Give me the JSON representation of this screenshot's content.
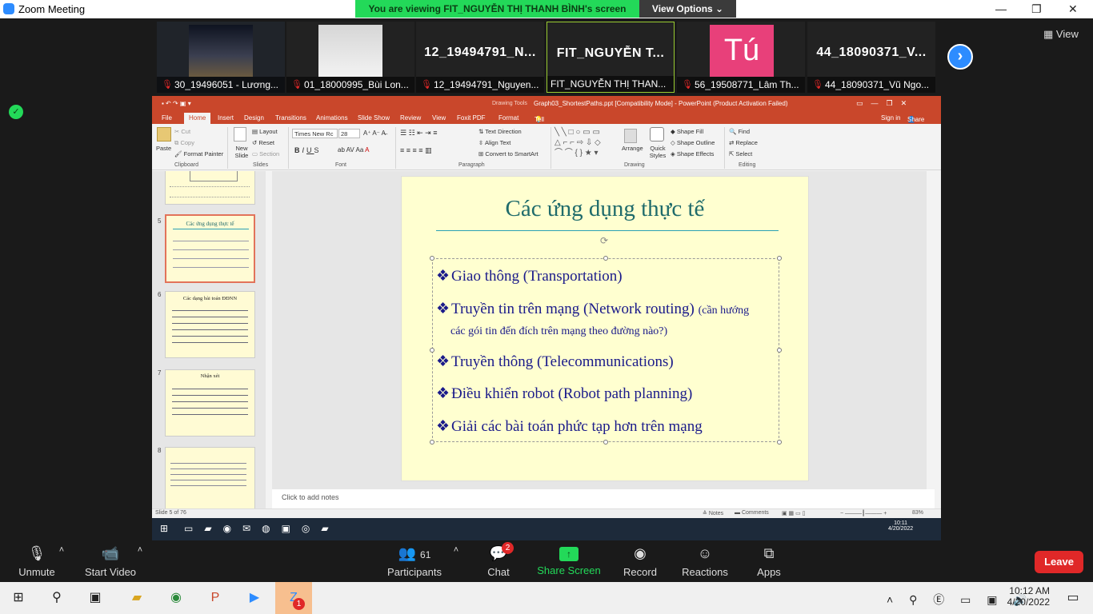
{
  "window": {
    "title": "Zoom Meeting",
    "share_banner": "You are viewing FIT_NGUYỄN THỊ THANH BÌNH's screen",
    "view_options": "View Options",
    "view_button": "View"
  },
  "participants_strip": [
    {
      "label": "30_19496051 - Lương...",
      "big": ""
    },
    {
      "label": "01_18000995_Bùi Lon...",
      "big": ""
    },
    {
      "label": "12_19494791_Nguyen...",
      "big": "12_19494791_N..."
    },
    {
      "label": "FIT_NGUYỄN THỊ THAN...",
      "big": "FIT_NGUYỄN T..."
    },
    {
      "label": "56_19508771_Lâm Th...",
      "big": "Tú"
    },
    {
      "label": "44_18090371_Vũ Ngo...",
      "big": "44_18090371_V..."
    }
  ],
  "ppt": {
    "title": "Graph03_ShortestPaths.ppt [Compatibility Mode] - PowerPoint (Product Activation Failed)",
    "drawing_tools": "Drawing Tools",
    "signin": "Sign in",
    "share": "Share",
    "tabs": [
      "File",
      "Home",
      "Insert",
      "Design",
      "Transitions",
      "Animations",
      "Slide Show",
      "Review",
      "View",
      "Foxit PDF",
      "Format"
    ],
    "tellme": "Tell me what you want to do...",
    "ribbon": {
      "paste": "Paste",
      "cut": "Cut",
      "copy": "Copy",
      "format_painter": "Format Painter",
      "new_slide": "New Slide",
      "layout": "Layout",
      "reset": "Reset",
      "section": "Section",
      "font_name": "Times New Rc",
      "font_size": "28",
      "text_direction": "Text Direction",
      "align_text": "Align Text",
      "convert_smartart": "Convert to SmartArt",
      "arrange": "Arrange",
      "quick_styles": "Quick Styles",
      "shape_fill": "Shape Fill",
      "shape_outline": "Shape Outline",
      "shape_effects": "Shape Effects",
      "find": "Find",
      "replace": "Replace",
      "select": "Select",
      "groups": [
        "Clipboard",
        "Slides",
        "Font",
        "Paragraph",
        "Drawing",
        "Editing"
      ]
    },
    "thumbnails": [
      {
        "num": "5",
        "title": "Các ứng dụng thực tế"
      },
      {
        "num": "6",
        "title": "Các dạng bài toán ĐĐNN"
      },
      {
        "num": "7",
        "title": "Nhận xét"
      },
      {
        "num": "8",
        "title": ""
      }
    ],
    "slide": {
      "title": "Các ứng dụng thực tế",
      "bullets": [
        {
          "text": "Giao thông (Transportation)",
          "extra": ""
        },
        {
          "text": "Truyền tin trên mạng (Network routing) ",
          "extra": "(cần hướng"
        },
        {
          "text": "",
          "extra": "các gói tin đến đích trên mạng theo đường nào?)"
        },
        {
          "text": "Truyền thông (Telecommunications)",
          "extra": ""
        },
        {
          "text": "Điều khiển robot (Robot path planning)",
          "extra": ""
        },
        {
          "text": "Giải các bài toán phức tạp hơn trên mạng",
          "extra": ""
        }
      ]
    },
    "notes_placeholder": "Click to add notes",
    "status": {
      "slide_of": "Slide 5 of 76",
      "notes": "Notes",
      "comments": "Comments",
      "zoom": "83%"
    },
    "inner_clock": {
      "time": "10:11",
      "date": "4/20/2022"
    }
  },
  "zoom_controls": {
    "unmute": "Unmute",
    "start_video": "Start Video",
    "participants": "Participants",
    "participants_count": "61",
    "chat": "Chat",
    "chat_badge": "2",
    "share_screen": "Share Screen",
    "record": "Record",
    "reactions": "Reactions",
    "apps": "Apps",
    "leave": "Leave"
  },
  "taskbar": {
    "time": "10:12 AM",
    "date": "4/20/2022",
    "zalo_badge": "1"
  },
  "colors": {
    "zoom_green": "#23d959",
    "zoom_blue": "#2d8cff",
    "leave_red": "#e02828",
    "ppt_red": "#c9472b",
    "slide_bg": "#ffffd0"
  }
}
